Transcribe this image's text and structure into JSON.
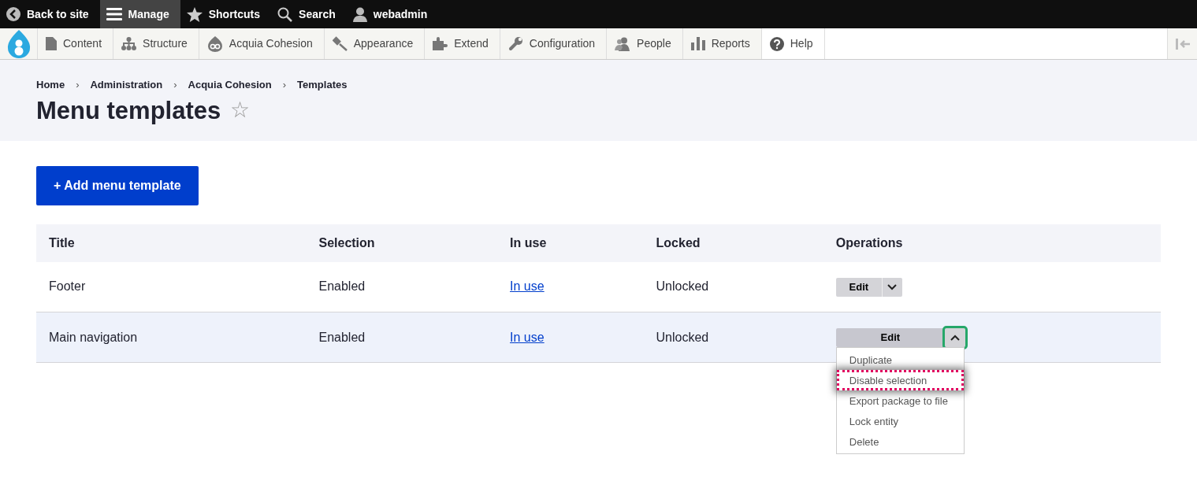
{
  "top_bar": [
    {
      "label": "Back to site",
      "selected": false
    },
    {
      "label": "Manage",
      "selected": true
    },
    {
      "label": "Shortcuts",
      "selected": false
    },
    {
      "label": "Search",
      "selected": false
    },
    {
      "label": "webadmin",
      "selected": false
    }
  ],
  "admin_menu": [
    {
      "label": "Content"
    },
    {
      "label": "Structure"
    },
    {
      "label": "Acquia Cohesion"
    },
    {
      "label": "Appearance"
    },
    {
      "label": "Extend"
    },
    {
      "label": "Configuration"
    },
    {
      "label": "People"
    },
    {
      "label": "Reports"
    },
    {
      "label": "Help"
    }
  ],
  "breadcrumb": [
    {
      "label": "Home"
    },
    {
      "separator_before": "›",
      "label": "Administration"
    },
    {
      "separator_before": "›",
      "label": "Acquia Cohesion"
    },
    {
      "separator_before": "›",
      "label": "Templates"
    }
  ],
  "page_title": "Menu templates",
  "favorite_star": "☆",
  "add_button": "+ Add menu template",
  "table": {
    "columns": [
      "Title",
      "Selection",
      "In use",
      "Locked",
      "Operations"
    ],
    "rows": [
      {
        "title": "Footer",
        "selection": "Enabled",
        "in_use": "In use",
        "locked": "Unlocked",
        "highlighted": false,
        "operations": {
          "edit": "Edit",
          "expanded": false
        }
      },
      {
        "title": "Main navigation",
        "selection": "Enabled",
        "in_use": "In use",
        "locked": "Unlocked",
        "highlighted": true,
        "operations": {
          "edit": "Edit",
          "expanded": true,
          "menu": [
            {
              "label": "Duplicate",
              "focused": false
            },
            {
              "label": "Disable selection",
              "focused": true
            },
            {
              "label": "Export package to file",
              "focused": false
            },
            {
              "label": "Lock entity",
              "focused": false
            },
            {
              "label": "Delete",
              "focused": false
            }
          ]
        }
      }
    ]
  }
}
